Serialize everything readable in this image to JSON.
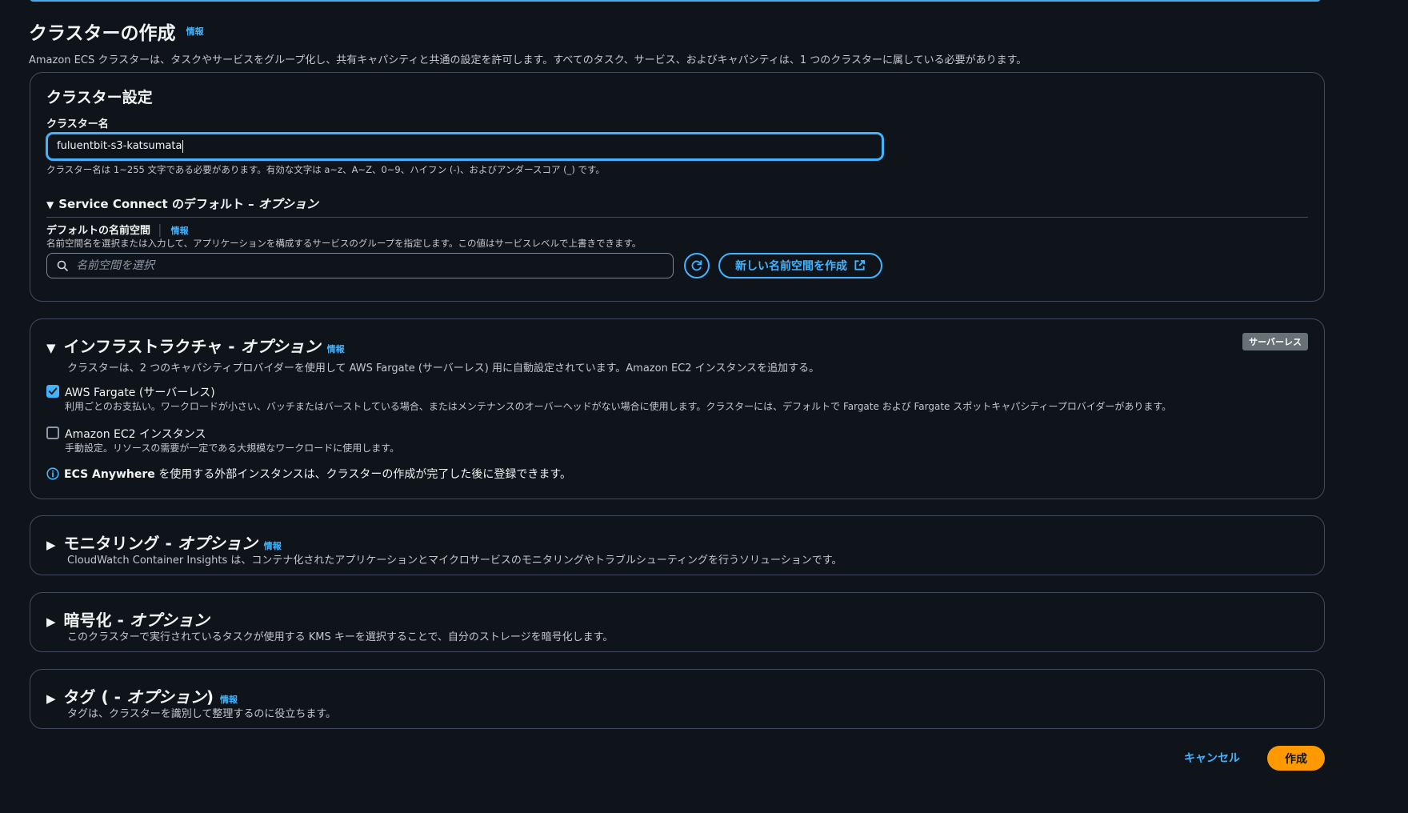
{
  "header": {
    "title": "クラスターの作成",
    "info": "情報",
    "description": "Amazon ECS クラスターは、タスクやサービスをグループ化し、共有キャパシティと共通の設定を許可します。すべてのタスク、サービス、およびキャパシティは、1 つのクラスターに属している必要があります。"
  },
  "cluster_settings": {
    "title": "クラスター設定",
    "name_label": "クラスター名",
    "name_value": "fuluentbit-s3-katsumata",
    "name_hint": "クラスター名は 1~255 文字である必要があります。有効な文字は a~z、A~Z、0~9、ハイフン (-)、およびアンダースコア (_) です。",
    "service_connect": {
      "title_prefix": "Service Connect のデフォルト – ",
      "title_option": "オプション",
      "namespace_label": "デフォルトの名前空間",
      "namespace_info": "情報",
      "namespace_hint": "名前空間名を選択または入力して、アプリケーションを構成するサービスのグループを指定します。この値はサービスレベルで上書きできます。",
      "search_placeholder": "名前空間を選択",
      "create_button": "新しい名前空間を作成"
    }
  },
  "infrastructure": {
    "title_prefix": "インフラストラクチャ - ",
    "title_option": "オプション",
    "info": "情報",
    "badge": "サーバーレス",
    "description": "クラスターは、2 つのキャパシティプロバイダーを使用して AWS Fargate (サーバーレス) 用に自動設定されています。Amazon EC2 インスタンスを追加する。",
    "fargate_label": "AWS Fargate (サーバーレス)",
    "fargate_checked": true,
    "fargate_desc": "利用ごとのお支払い。ワークロードが小さい、バッチまたはバーストしている場合、またはメンテナンスのオーバーヘッドがない場合に使用します。クラスターには、デフォルトで Fargate および Fargate スポットキャパシティープロバイダーがあります。",
    "ec2_label": "Amazon EC2 インスタンス",
    "ec2_checked": false,
    "ec2_desc": "手動設定。リソースの需要が一定である大規模なワークロードに使用します。",
    "anywhere_bold": "ECS Anywhere",
    "anywhere_text": " を使用する外部インスタンスは、クラスターの作成が完了した後に登録できます。"
  },
  "monitoring": {
    "title_prefix": "モニタリング - ",
    "title_option": "オプション",
    "info": "情報",
    "description": "CloudWatch Container Insights は、コンテナ化されたアプリケーションとマイクロサービスのモニタリングやトラブルシューティングを行うソリューションです。"
  },
  "encryption": {
    "title_prefix": "暗号化 - ",
    "title_option": "オプション",
    "description": "このクラスターで実行されているタスクが使用する KMS キーを選択することで、自分のストレージを暗号化します。"
  },
  "tags": {
    "title_prefix": "タグ ( - ",
    "title_option": "オプション",
    "title_suffix": ")",
    "info": "情報",
    "description": "タグは、クラスターを識別して整理するのに役立ちます。"
  },
  "footer": {
    "cancel": "キャンセル",
    "create": "作成"
  },
  "colors": {
    "background": "#0f141a",
    "accent": "#42b4ff",
    "primary_button": "#ff9900",
    "border": "#414d5c"
  }
}
